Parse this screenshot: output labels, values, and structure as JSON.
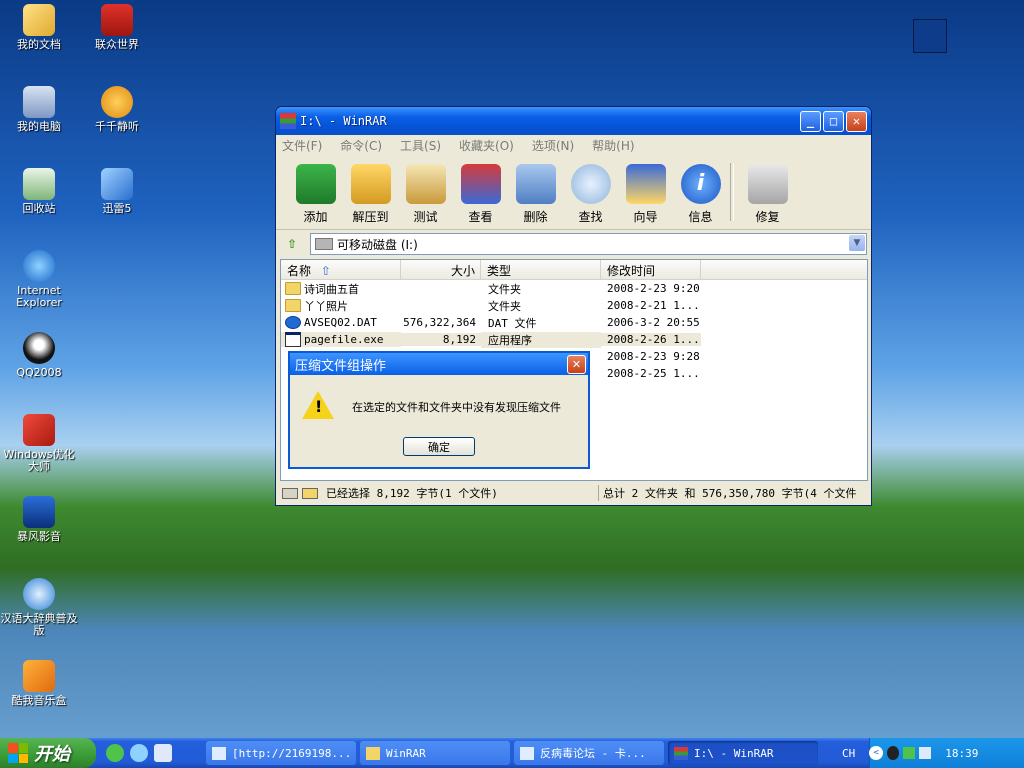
{
  "desktop": {
    "icons": [
      {
        "label": "我的文档"
      },
      {
        "label": "联众世界"
      },
      {
        "label": "我的电脑"
      },
      {
        "label": "千千静听"
      },
      {
        "label": "回收站"
      },
      {
        "label": "迅雷5"
      },
      {
        "label": "Internet Explorer"
      },
      {
        "label": "QQ2008"
      },
      {
        "label": "Windows优化大师"
      },
      {
        "label": "暴风影音"
      },
      {
        "label": "汉语大辞典普及版"
      },
      {
        "label": "酷我音乐盒"
      }
    ]
  },
  "window": {
    "title": "I:\\ - WinRAR",
    "menu": [
      "文件(F)",
      "命令(C)",
      "工具(S)",
      "收藏夹(O)",
      "选项(N)",
      "帮助(H)"
    ],
    "toolbar": [
      "添加",
      "解压到",
      "测试",
      "查看",
      "删除",
      "查找",
      "向导",
      "信息",
      "修复"
    ],
    "address": "可移动磁盘 (I:)",
    "columns": [
      "名称",
      "大小",
      "类型",
      "修改时间"
    ],
    "files": [
      {
        "name": "诗词曲五首",
        "size": "",
        "type": "文件夹",
        "modified": "2008-2-23 9:20"
      },
      {
        "name": "丫丫照片",
        "size": "",
        "type": "文件夹",
        "modified": "2008-2-21 1..."
      },
      {
        "name": "AVSEQ02.DAT",
        "size": "576,322,364",
        "type": "DAT 文件",
        "modified": "2006-3-2 20:55"
      },
      {
        "name": "pagefile.exe",
        "size": "8,192",
        "type": "应用程序",
        "modified": "2008-2-26 1..."
      },
      {
        "name": "",
        "size": "",
        "type": "",
        "modified": "2008-2-23 9:28"
      },
      {
        "name": "",
        "size": "",
        "type": "",
        "modified": "2008-2-25 1..."
      }
    ],
    "status_left": "已经选择 8,192 字节(1 个文件)",
    "status_right": "总计 2 文件夹 和 576,350,780 字节(4 个文件"
  },
  "dialog": {
    "title": "压缩文件组操作",
    "message": "在选定的文件和文件夹中没有发现压缩文件",
    "ok": "确定"
  },
  "taskbar": {
    "start": "开始",
    "tasks": [
      "[http://2169198...",
      "WinRAR",
      "反病毒论坛 - 卡...",
      "I:\\ - WinRAR"
    ],
    "lang": "CH",
    "clock": "18:39"
  }
}
